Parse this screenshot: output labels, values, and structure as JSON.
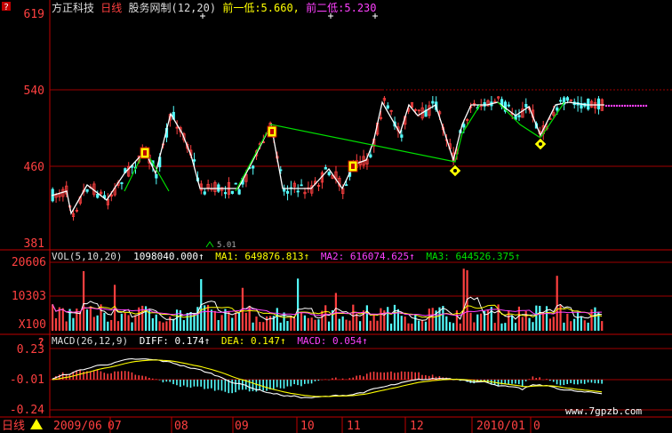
{
  "header": {
    "stock_name": "方正科技",
    "period": "日线",
    "indicator": "股务网制(12,20)",
    "low1_label": "前一低:",
    "low1_value": "5.660,",
    "low2_label": "前二低:",
    "low2_value": "5.230"
  },
  "colors": {
    "background": "#000000",
    "axis_red": "#c00000",
    "grid_red": "#a00000",
    "up_red": "#ff4040",
    "down_cyan": "#54ffff",
    "white": "#ffffff",
    "yellow": "#ffff00",
    "magenta": "#ff40ff",
    "green": "#00e000"
  },
  "price_panel": {
    "y_ticks": [
      "619",
      "540",
      "460",
      "381"
    ],
    "marker_label": "5.01"
  },
  "vol_panel": {
    "title": "VOL(5,10,20)",
    "value": "1098040.000↑",
    "ma1": "MA1: 649876.813↑",
    "ma2": "MA2: 616074.625↑",
    "ma3": "MA3: 644526.375↑",
    "y_ticks": [
      "20606",
      "10303"
    ],
    "multiplier": "X100"
  },
  "macd_panel": {
    "title": "MACD(26,12,9)",
    "diff": "DIFF: 0.174↑",
    "dea": "DEA: 0.147↑",
    "macd": "MACD: 0.054↑",
    "y_ticks": [
      "0.23",
      "-0.01",
      "-0.24"
    ]
  },
  "x_axis": {
    "corner_label": "日线",
    "labels": [
      "2009/06",
      "07",
      "08",
      "09",
      "10",
      "11",
      "12",
      "2010/01",
      "0"
    ]
  },
  "watermark": "www.7gpzb.com",
  "chart_data": [
    {
      "type": "candlestick",
      "title": "方正科技 日线",
      "y_ticks": [
        619,
        540,
        460,
        381
      ],
      "ylim": [
        381,
        619
      ],
      "annotations": [
        "前一低: 5.660",
        "前二低: 5.230"
      ]
    },
    {
      "type": "bar",
      "title": "VOL(5,10,20)",
      "y_ticks": [
        20606,
        10303
      ],
      "series": [
        {
          "name": "VOL",
          "last": "1098040.000"
        },
        {
          "name": "MA1",
          "last": "649876.813"
        },
        {
          "name": "MA2",
          "last": "616074.625"
        },
        {
          "name": "MA3",
          "last": "644526.375"
        }
      ]
    },
    {
      "type": "line",
      "title": "MACD(26,12,9)",
      "y_ticks": [
        0.23,
        -0.01,
        -0.24
      ],
      "ylim": [
        -0.24,
        0.23
      ],
      "series": [
        {
          "name": "DIFF",
          "last": 0.174
        },
        {
          "name": "DEA",
          "last": 0.147
        },
        {
          "name": "MACD",
          "last": 0.054
        }
      ]
    }
  ]
}
